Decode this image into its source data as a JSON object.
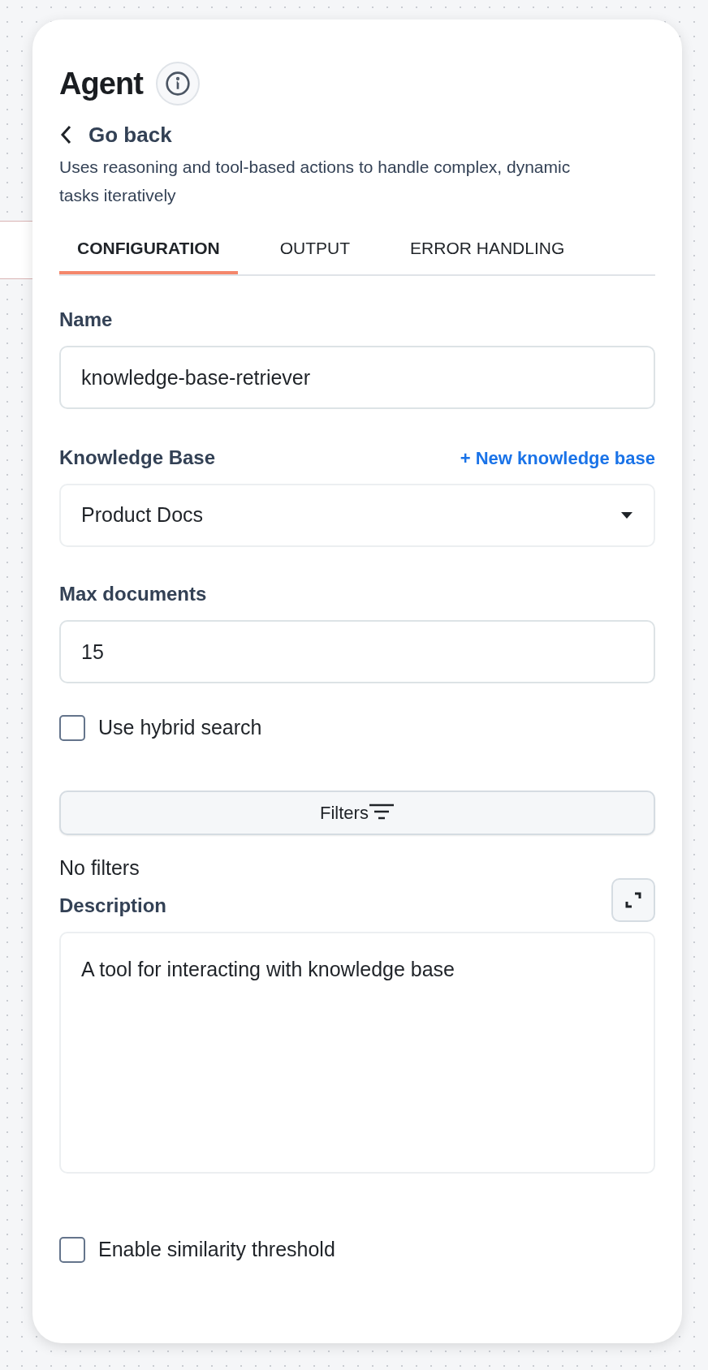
{
  "panel": {
    "title": "Agent",
    "back_label": "Go back",
    "description": "Uses reasoning and tool-based actions to handle complex, dynamic tasks iteratively"
  },
  "tabs": [
    {
      "label": "CONFIGURATION",
      "selected": true
    },
    {
      "label": "OUTPUT",
      "selected": false
    },
    {
      "label": "ERROR HANDLING",
      "selected": false
    }
  ],
  "form": {
    "name": {
      "label": "Name",
      "value": "knowledge-base-retriever"
    },
    "knowledge_base": {
      "label": "Knowledge Base",
      "link": "+ New knowledge base",
      "value": "Product Docs"
    },
    "max_documents": {
      "label": "Max documents",
      "value": "15"
    },
    "hybrid_search": {
      "label": "Use hybrid search",
      "checked": false
    },
    "filters": {
      "button": "Filters",
      "empty_text": "No filters"
    },
    "description": {
      "label": "Description",
      "value": "A tool for interacting with knowledge base"
    },
    "similarity_threshold": {
      "label": "Enable similarity threshold",
      "checked": false
    }
  }
}
